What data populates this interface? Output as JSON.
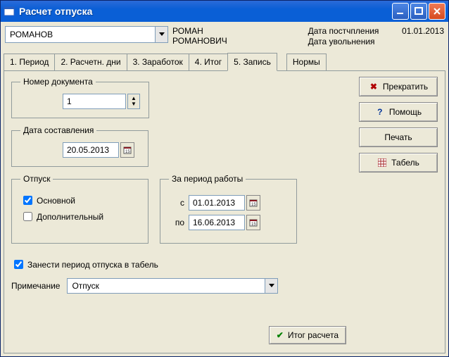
{
  "window": {
    "title": "Расчет отпуска"
  },
  "header": {
    "employee_surname": "РОМАНОВ",
    "employee_full": "РОМАН\nРОМАНОВИЧ",
    "hire_label": "Дата постчпления",
    "hire_date": "01.01.2013",
    "fire_label": "Дата увольнения",
    "fire_date": ""
  },
  "tabs": {
    "t1": "1. Период",
    "t2": "2. Расчетн. дни",
    "t3": "3. Заработок",
    "t4": "4. Итог",
    "t5": "5. Запись",
    "t6": "Нормы"
  },
  "form": {
    "doc_num_label": "Номер документа",
    "doc_num_value": "1",
    "doc_date_label": "Дата составления",
    "doc_date_value": "20.05.2013",
    "vac_group": "Отпуск",
    "vac_main": "Основной",
    "vac_extra": "Дополнительный",
    "period_group": "За период работы",
    "period_from_label": "с",
    "period_from": "01.01.2013",
    "period_to_label": "по",
    "period_to": "16.06.2013",
    "to_tabel": "Занести период отпуска в табель",
    "note_label": "Примечание",
    "note_value": "Отпуск"
  },
  "buttons": {
    "stop": "Прекратить",
    "help": "Помощь",
    "print": "Печать",
    "tabel": "Табель",
    "result": "Итог расчета"
  }
}
